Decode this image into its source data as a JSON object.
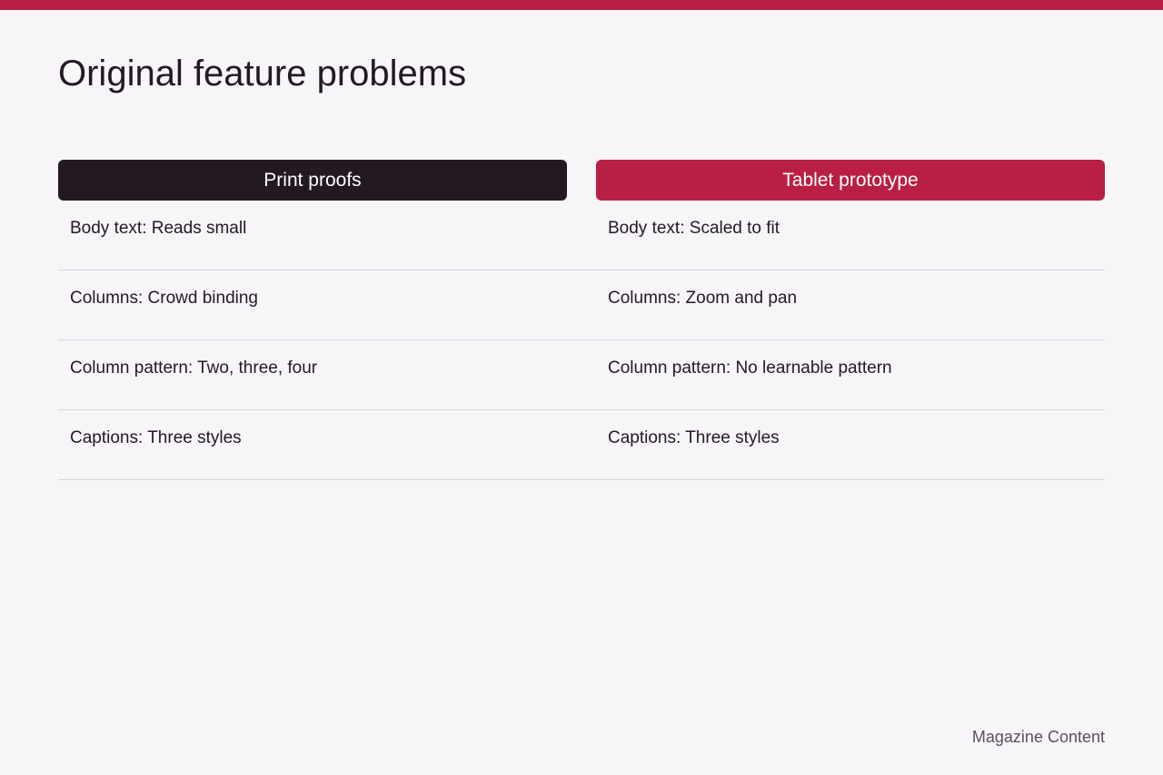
{
  "title": "Original feature problems",
  "accent_color": "#b91f45",
  "dark_color": "#231922",
  "columns": [
    {
      "label": "Print proofs"
    },
    {
      "label": "Tablet prototype"
    }
  ],
  "rows": [
    {
      "left": "Body text: Reads small",
      "right": "Body text: Scaled to fit"
    },
    {
      "left": "Columns: Crowd binding",
      "right": "Columns: Zoom and pan"
    },
    {
      "left": "Column pattern: Two, three, four",
      "right": "Column pattern: No learnable pattern"
    },
    {
      "left": "Captions: Three styles",
      "right": "Captions: Three styles"
    }
  ],
  "footer": "Magazine Content"
}
